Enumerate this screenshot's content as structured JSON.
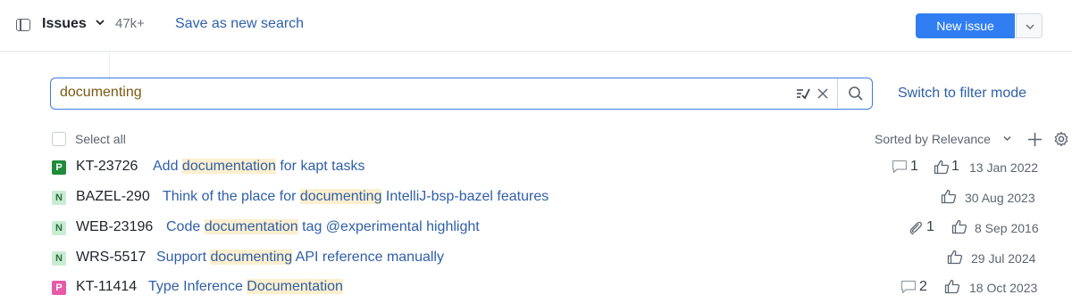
{
  "header": {
    "title": "Issues",
    "count": "47k+",
    "save_search": "Save as new search",
    "new_issue": "New issue"
  },
  "search": {
    "query": "documenting",
    "switch_mode": "Switch to filter mode"
  },
  "list": {
    "select_all": "Select all",
    "sorted_by": "Sorted by Relevance"
  },
  "issues": [
    {
      "badge": "P",
      "id": "KT-23726",
      "summary_pre": "Add ",
      "summary_hl": "documentation",
      "summary_post": " for kapt tasks",
      "comments": "1",
      "attachments": "",
      "votes": "1",
      "date": "13 Jan 2022"
    },
    {
      "badge": "N",
      "id": "BAZEL-290",
      "summary_pre": "Think of the place for ",
      "summary_hl": "documenting",
      "summary_post": " IntelliJ-bsp-bazel features",
      "comments": "",
      "attachments": "",
      "votes": "",
      "date": "30 Aug 2023"
    },
    {
      "badge": "N",
      "id": "WEB-23196",
      "summary_pre": "Code ",
      "summary_hl": "documentation",
      "summary_post": " tag @experimental highlight",
      "comments": "",
      "attachments": "1",
      "votes": "",
      "date": "8 Sep 2016"
    },
    {
      "badge": "N",
      "id": "WRS-5517",
      "summary_pre": "Support ",
      "summary_hl": "documenting",
      "summary_post": " API reference manually",
      "comments": "",
      "attachments": "",
      "votes": "",
      "date": "29 Jul 2024"
    },
    {
      "badge": "P",
      "id": "KT-11414",
      "summary_pre": "Type Inference ",
      "summary_hl": "Documentation",
      "summary_post": "",
      "comments": "2",
      "attachments": "",
      "votes": "",
      "date": "18 Oct 2023"
    }
  ],
  "colors": {
    "accent": "#307ef2",
    "link": "#2f5fa8",
    "highlight": "#fcefcf",
    "priority_show_stopper": "#1f8b3b",
    "priority_normal": "#c9edd3",
    "priority_pink": "#e85aa8"
  },
  "icons": [
    "sidebar-toggle-icon",
    "chevron-down-icon",
    "check-spelling-icon",
    "close-icon",
    "search-icon",
    "plus-icon",
    "gear-icon",
    "comment-icon",
    "thumbs-up-icon",
    "paperclip-icon"
  ]
}
